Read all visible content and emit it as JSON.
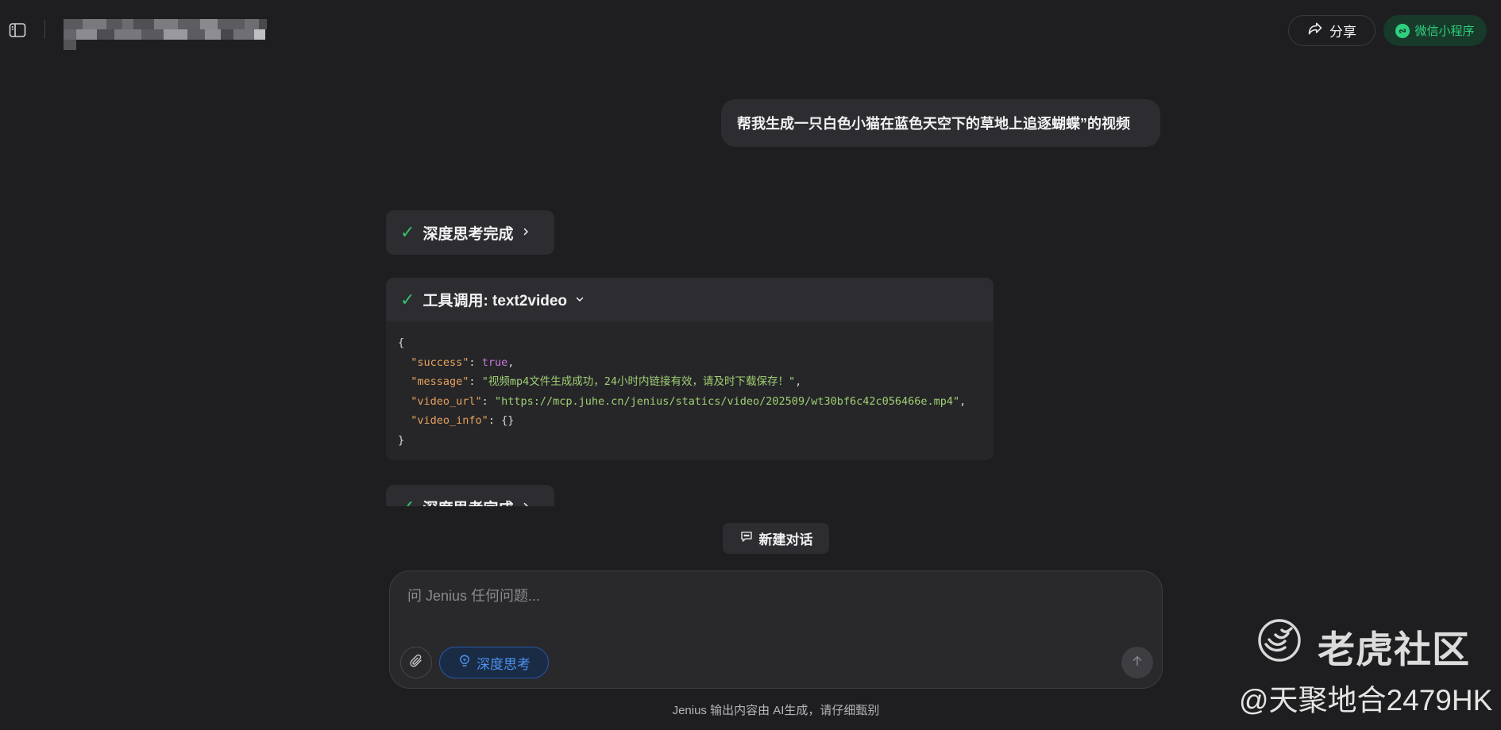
{
  "topbar": {
    "share_label": "分享",
    "wechat_label": "微信小程序"
  },
  "chat": {
    "user_message": "帮我生成一只白色小猫在蓝色天空下的草地上追逐蝴蝶”的视频",
    "thinking_status": "深度思考完成",
    "tool_call_label": "工具调用: text2video",
    "tool_result": {
      "open_brace": "{",
      "close_brace": "}",
      "success_key": "\"success\"",
      "success_value": "true",
      "message_key": "\"message\"",
      "message_value": "\"视频mp4文件生成成功，24小时内链接有效，请及时下载保存！\"",
      "video_url_key": "\"video_url\"",
      "video_url_value": "\"https://mcp.juhe.cn/jenius/statics/video/202509/wt30bf6c42c056466e.mp4\"",
      "video_info_key": "\"video_info\"",
      "video_info_value": "{}"
    },
    "thinking_status_2": "深度思考完成"
  },
  "composer": {
    "new_chat_label": "新建对话",
    "input_placeholder": "问 Jenius 任何问题...",
    "deep_think_label": "深度思考",
    "disclaimer": "Jenius 输出内容由 AI生成，请仔细甄别"
  },
  "watermark": {
    "brand": "老虎社区",
    "handle": "@天聚地合2479HK"
  },
  "colors": {
    "background": "#1e1e20",
    "bubble": "#2d2d31",
    "check_green": "#33c26b",
    "wechat_green": "#2fd07d",
    "deep_think_blue": "#4d92f0"
  }
}
